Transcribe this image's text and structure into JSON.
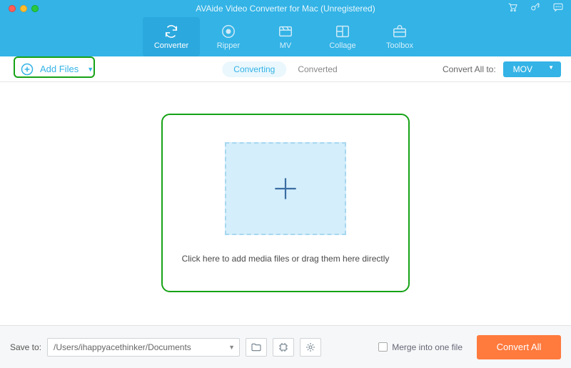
{
  "window": {
    "title": "AVAide Video Converter for Mac (Unregistered)"
  },
  "titlebar_icons": [
    "cart-icon",
    "key-icon",
    "chat-icon"
  ],
  "nav": [
    {
      "key": "converter",
      "label": "Converter",
      "active": true
    },
    {
      "key": "ripper",
      "label": "Ripper",
      "active": false
    },
    {
      "key": "mv",
      "label": "MV",
      "active": false
    },
    {
      "key": "collage",
      "label": "Collage",
      "active": false
    },
    {
      "key": "toolbox",
      "label": "Toolbox",
      "active": false
    }
  ],
  "subbar": {
    "add_files_label": "Add Files",
    "tabs": {
      "converting": "Converting",
      "converted": "Converted",
      "active": "converting"
    },
    "convert_all_to_label": "Convert All to:",
    "format_selected": "MOV"
  },
  "dropzone": {
    "hint": "Click here to add media files or drag them here directly"
  },
  "bottom": {
    "save_to_label": "Save to:",
    "save_path": "/Users/ihappyacethinker/Documents",
    "merge_label": "Merge into one file",
    "merge_checked": false,
    "convert_all_button": "Convert All"
  },
  "colors": {
    "brand": "#33b3e6",
    "accent": "#ff7a3d",
    "highlight": "#16a216"
  }
}
